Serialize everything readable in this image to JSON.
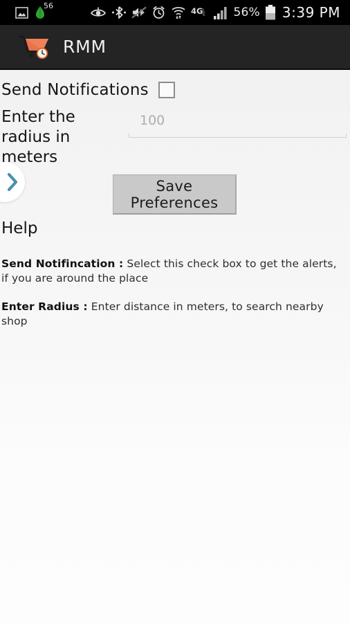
{
  "status_bar": {
    "left_icons": [
      {
        "name": "screenshot-image-icon",
        "glyph": "image"
      },
      {
        "name": "green-leaf-icon",
        "glyph": "leaf",
        "badge": "56"
      }
    ],
    "right_icons": [
      {
        "name": "smart-stay-eye-icon",
        "glyph": "eye"
      },
      {
        "name": "bluetooth-icon",
        "glyph": "bluetooth"
      },
      {
        "name": "sound-muted-icon",
        "glyph": "mute"
      },
      {
        "name": "alarm-clock-icon",
        "glyph": "alarm"
      },
      {
        "name": "wifi-icon",
        "glyph": "wifi"
      },
      {
        "name": "network-4glte-icon",
        "glyph": "4glte"
      },
      {
        "name": "signal-bars-icon",
        "glyph": "signal"
      }
    ],
    "battery_percent": "56%",
    "battery_icon_name": "battery-icon",
    "clock": "3:39 PM"
  },
  "action_bar": {
    "app_icon_name": "shopping-cart-clock-icon",
    "title": "RMM",
    "icon_color": "#e8734a",
    "background": "#242424"
  },
  "drawer": {
    "handle_icon_name": "chevron-right-icon",
    "handle_color": "#4a90ad"
  },
  "settings": {
    "notifications": {
      "label": "Send Notifications",
      "checked": false
    },
    "radius": {
      "label": "Enter the radius in meters",
      "value": "",
      "placeholder": "100"
    },
    "save_button_label": "Save Preferences"
  },
  "help": {
    "title": "Help",
    "items": [
      {
        "term": "Send Notifincation :",
        "description": "Select this check box to get the alerts, if you are around the place"
      },
      {
        "term": "Enter Radius :",
        "description": "Enter distance in meters, to search nearby shop"
      }
    ]
  }
}
